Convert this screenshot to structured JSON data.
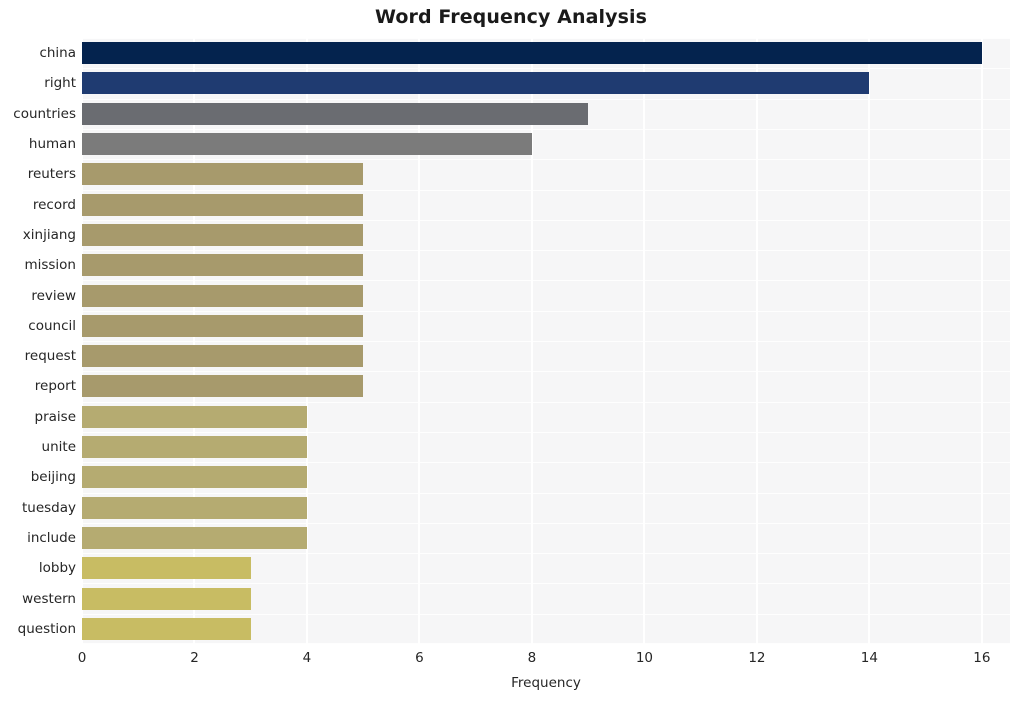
{
  "chart_data": {
    "type": "bar",
    "orientation": "horizontal",
    "title": "Word Frequency Analysis",
    "xlabel": "Frequency",
    "ylabel": "",
    "categories": [
      "china",
      "right",
      "countries",
      "human",
      "reuters",
      "record",
      "xinjiang",
      "mission",
      "review",
      "council",
      "request",
      "report",
      "praise",
      "unite",
      "beijing",
      "tuesday",
      "include",
      "lobby",
      "western",
      "question"
    ],
    "values": [
      16,
      14,
      9,
      8,
      5,
      5,
      5,
      5,
      5,
      5,
      5,
      5,
      4,
      4,
      4,
      4,
      4,
      3,
      3,
      3
    ],
    "bar_colors": [
      "#04234e",
      "#1f3b71",
      "#6a6c71",
      "#7b7b7b",
      "#a79a6c",
      "#a79a6c",
      "#a79a6c",
      "#a79a6c",
      "#a79a6c",
      "#a79a6c",
      "#a79a6c",
      "#a79a6c",
      "#b5ab71",
      "#b5ab71",
      "#b5ab71",
      "#b5ab71",
      "#b5ab71",
      "#c8bc63",
      "#c8bc63",
      "#c8bc63"
    ],
    "xlim": [
      0,
      16.5
    ],
    "xticks": [
      0,
      2,
      4,
      6,
      8,
      10,
      12,
      14,
      16
    ],
    "xtick_labels": [
      "0",
      "2",
      "4",
      "6",
      "8",
      "10",
      "12",
      "14",
      "16"
    ],
    "grid": true,
    "grid_axis": "both",
    "legend": "none",
    "plot_background": "#f6f6f7",
    "figure_background": "#ffffff",
    "gridline_color": "#ffffff"
  }
}
